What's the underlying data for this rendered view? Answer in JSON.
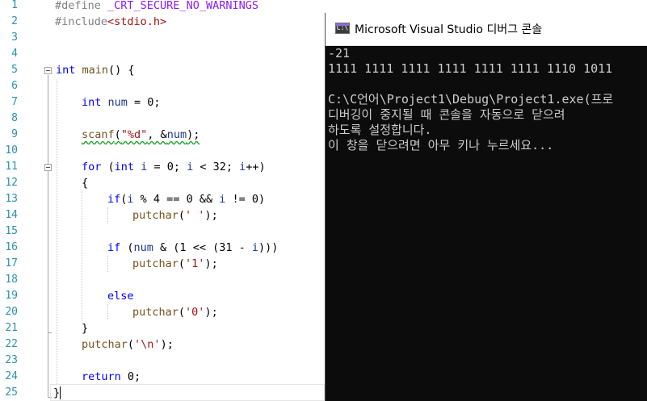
{
  "editor": {
    "line_numbers": [
      "1",
      "2",
      "3",
      "4",
      "5",
      "6",
      "7",
      "8",
      "9",
      "10",
      "11",
      "12",
      "13",
      "14",
      "15",
      "16",
      "17",
      "18",
      "19",
      "20",
      "21",
      "22",
      "23",
      "24",
      "25"
    ],
    "code": {
      "l1_directive": "#define ",
      "l1_macro": "_CRT_SECURE_NO_WARNINGS",
      "l2_directive": "#include",
      "l2_header": "<stdio.h>",
      "l5_kw": "int",
      "l5_fn": " main",
      "l5_rest": "() {",
      "l7_kw": "int",
      "l7_var": " num",
      "l7_rest": " = 0;",
      "l9_fn": "scanf",
      "l9_open": "(",
      "l9_str": "\"%d\"",
      "l9_mid": ", &",
      "l9_var": "num",
      "l9_close": ");",
      "l11_kw": "for",
      "l11_a": " (",
      "l11_kw2": "int",
      "l11_var1": " i",
      "l11_b": " = 0; ",
      "l11_var2": "i",
      "l11_c": " < 32; ",
      "l11_var3": "i",
      "l11_d": "++)",
      "l12": "{",
      "l13_kw": "if",
      "l13_a": "(",
      "l13_var1": "i",
      "l13_b": " % 4 == 0 && ",
      "l13_var2": "i",
      "l13_c": " != 0)",
      "l14_fn": "putchar",
      "l14_a": "(",
      "l14_str": "' '",
      "l14_b": ");",
      "l16_kw": "if",
      "l16_a": " (",
      "l16_var1": "num",
      "l16_b": " & (1 << (31 - ",
      "l16_var2": "i",
      "l16_c": ")))",
      "l17_fn": "putchar",
      "l17_a": "(",
      "l17_str": "'1'",
      "l17_b": ");",
      "l19_kw": "else",
      "l20_fn": "putchar",
      "l20_a": "(",
      "l20_str": "'0'",
      "l20_b": ");",
      "l21": "}",
      "l22_fn": "putchar",
      "l22_a": "(",
      "l22_str": "'\\n'",
      "l22_b": ");",
      "l24_kw": "return",
      "l24_rest": " 0;",
      "l25": "}"
    }
  },
  "console": {
    "title": "Microsoft Visual Studio 디버그 콘솔",
    "icon_text": "C:\\",
    "lines": [
      "-21",
      "1111 1111 1111 1111 1111 1111 1110 1011",
      "",
      "C:\\C언어\\Project1\\Debug\\Project1.exe(프로",
      "디버깅이 중지될 때 콘솔을 자동으로 닫으려",
      "하도록 설정합니다.",
      "이 창을 닫으려면 아무 키나 누르세요..."
    ]
  },
  "colors": {
    "keyword": "#0000ff",
    "preprocessor": "#808080",
    "string": "#a31515",
    "function": "#74531f",
    "variable": "#1f377f",
    "macro": "#8a1bff",
    "line_number": "#2b91af",
    "console_bg": "#0c0c0c",
    "console_text": "#cccccc"
  }
}
